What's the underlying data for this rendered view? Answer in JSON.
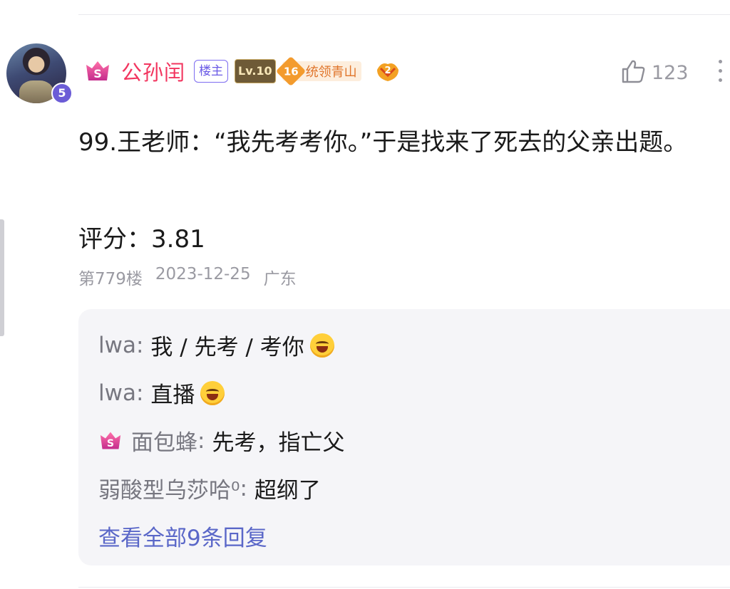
{
  "post": {
    "username": "公孙闰",
    "owner_tag": "楼主",
    "level": "Lv.10",
    "rank_number": "16",
    "rank_title": "统领青山",
    "avatar_badge": "5",
    "like_count": "123",
    "text": "99.王老师：“我先考考你。”于是找来了死去的父亲出题。",
    "score": "评分：3.81",
    "floor": "第779楼",
    "date": "2023-12-25",
    "location": "广东"
  },
  "replies": [
    {
      "author": "lwa",
      "sep": ":",
      "text": "我 / 先考 / 考你",
      "emoji": "grinning-squint-emoji"
    },
    {
      "author": "lwa",
      "sep": ":",
      "text": "直播",
      "emoji": "laughing-emoji"
    },
    {
      "author": "面包蜂",
      "sep": ":",
      "text": "先考，指亡父",
      "vip": true
    },
    {
      "author": "弱酸型乌莎哈⁰",
      "sep": ":",
      "text": "超纲了"
    }
  ],
  "view_all_label": "查看全部9条回复",
  "colors": {
    "username": "#f2355f",
    "owner_tag": "#6a5ae6",
    "link": "#5a67c8",
    "reply_bg": "#f5f5f8"
  },
  "icons": [
    "vip-icon",
    "level-badge",
    "rank-badge",
    "medal-icon",
    "thumbs-up-icon",
    "more-icon"
  ]
}
